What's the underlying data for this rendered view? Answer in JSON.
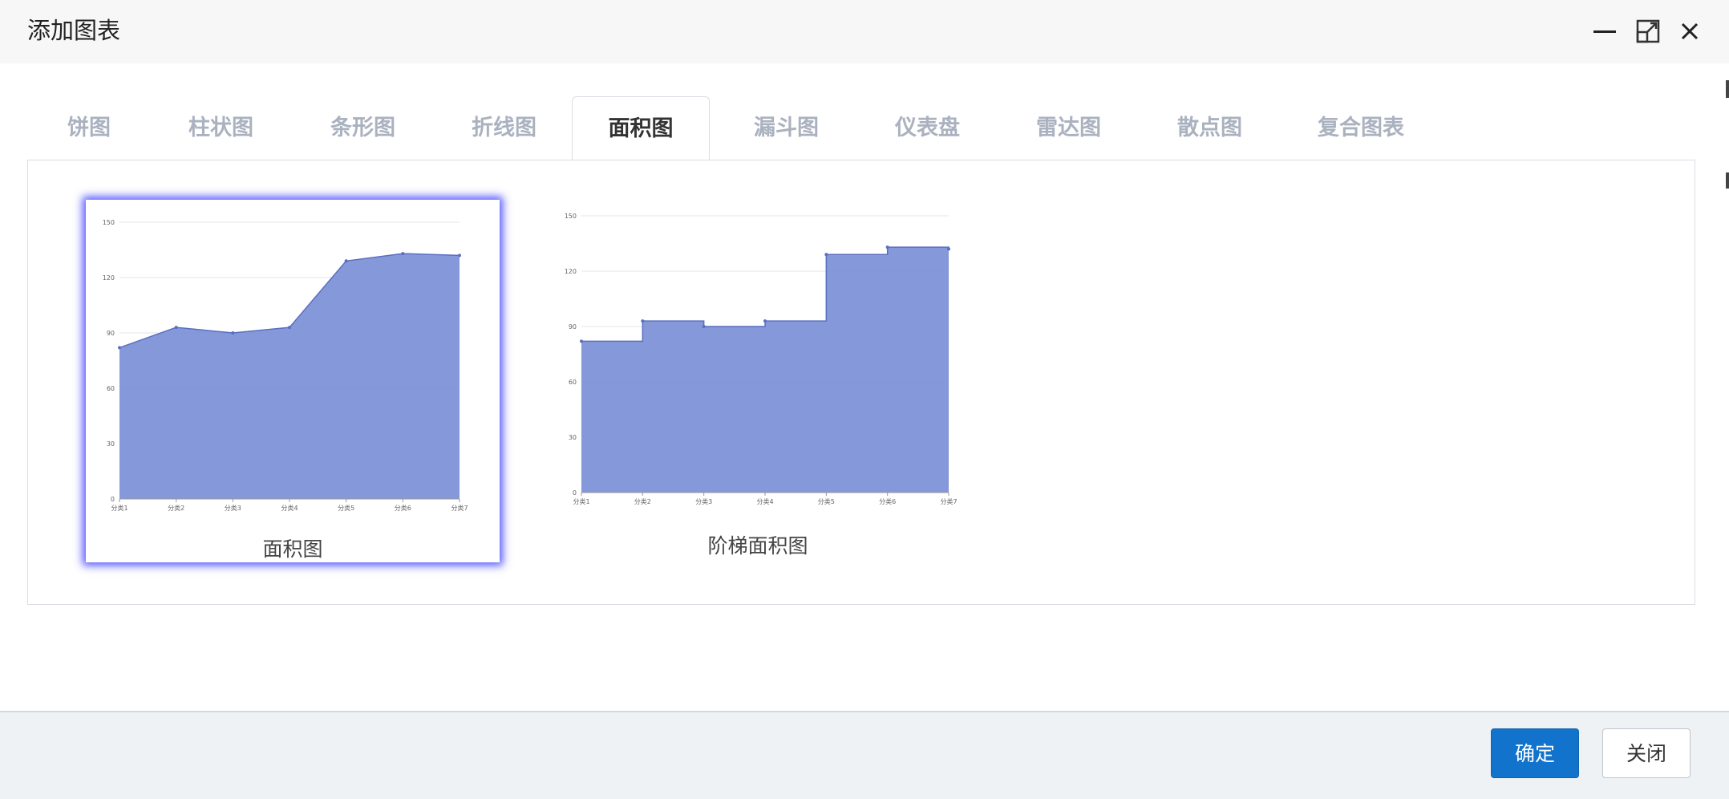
{
  "dialog": {
    "title": "添加图表"
  },
  "tabs": [
    {
      "label": "饼图",
      "active": false
    },
    {
      "label": "柱状图",
      "active": false
    },
    {
      "label": "条形图",
      "active": false
    },
    {
      "label": "折线图",
      "active": false
    },
    {
      "label": "面积图",
      "active": true
    },
    {
      "label": "漏斗图",
      "active": false
    },
    {
      "label": "仪表盘",
      "active": false
    },
    {
      "label": "雷达图",
      "active": false
    },
    {
      "label": "散点图",
      "active": false
    },
    {
      "label": "复合图表",
      "active": false
    }
  ],
  "options": [
    {
      "label": "面积图",
      "selected": true
    },
    {
      "label": "阶梯面积图",
      "selected": false
    }
  ],
  "chart_data": [
    {
      "type": "area",
      "categories": [
        "分类1",
        "分类2",
        "分类3",
        "分类4",
        "分类5",
        "分类6",
        "分类7"
      ],
      "values": [
        82,
        93,
        90,
        93,
        129,
        133,
        132
      ],
      "ylim": [
        0,
        150
      ],
      "yticks": [
        0,
        30,
        60,
        90,
        120,
        150
      ],
      "grid": true,
      "color": "#7b8fd6"
    },
    {
      "type": "area",
      "step": true,
      "categories": [
        "分类1",
        "分类2",
        "分类3",
        "分类4",
        "分类5",
        "分类6",
        "分类7"
      ],
      "values": [
        82,
        93,
        90,
        93,
        129,
        133,
        132
      ],
      "ylim": [
        0,
        150
      ],
      "yticks": [
        0,
        30,
        60,
        90,
        120,
        150
      ],
      "grid": true,
      "color": "#7b8fd6"
    }
  ],
  "footer": {
    "ok_label": "确定",
    "close_label": "关闭"
  }
}
